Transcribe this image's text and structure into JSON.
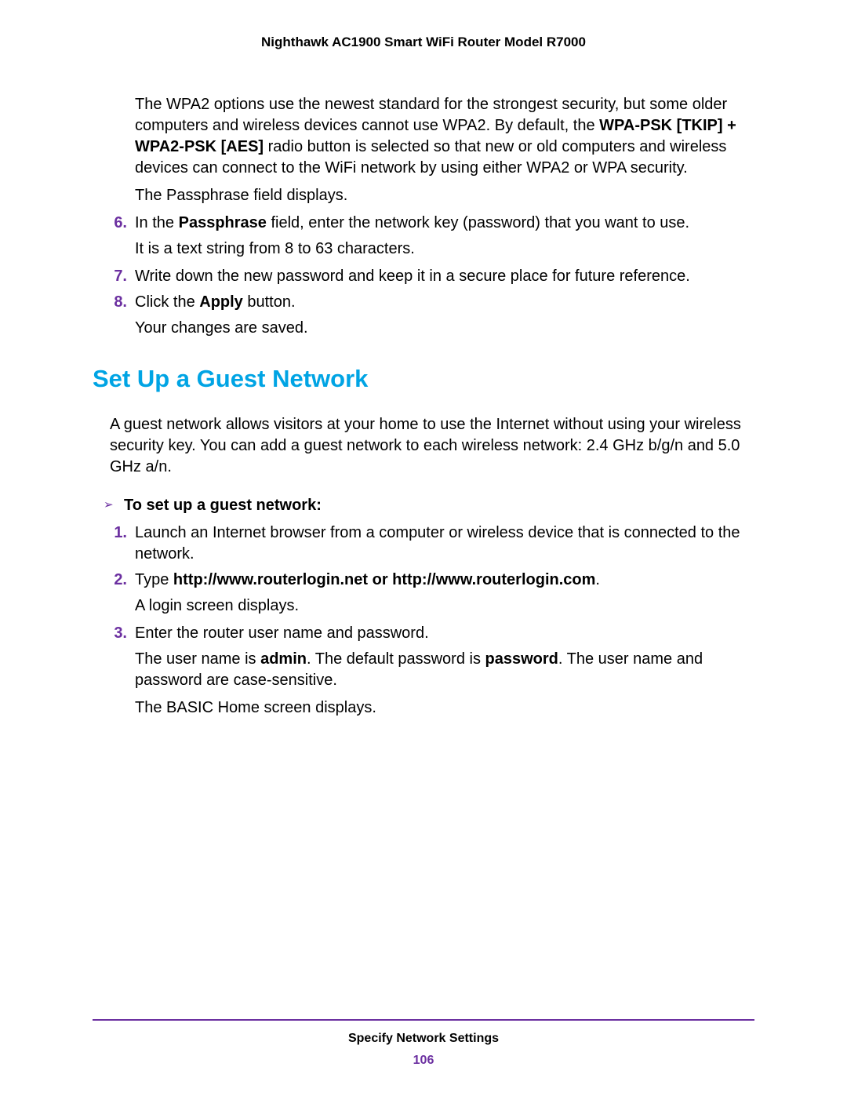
{
  "header": {
    "title": "Nighthawk AC1900 Smart WiFi Router Model R7000"
  },
  "section1": {
    "p1a": "The WPA2 options use the newest standard for the strongest security, but some older computers and wireless devices cannot use WPA2. By default, the ",
    "p1b": "WPA-PSK [TKIP] + WPA2-PSK [AES]",
    "p1c": " radio button is selected so that new or old computers and wireless devices can connect to the WiFi network by using either WPA2 or WPA security.",
    "p2": "The Passphrase field displays.",
    "i6": {
      "n": "6.",
      "a": "In the ",
      "b": "Passphrase",
      "c": " field, enter the network key (password) that you want to use.",
      "sub": "It is a text string from 8 to 63 characters."
    },
    "i7": {
      "n": "7.",
      "a": "Write down the new password and keep it in a secure place for future reference."
    },
    "i8": {
      "n": "8.",
      "a": "Click the ",
      "b": "Apply",
      "c": " button.",
      "sub": "Your changes are saved."
    }
  },
  "h2": "Set Up a Guest Network",
  "intro": "A guest network allows visitors at your home to use the Internet without using your wireless security key. You can add a guest network to each wireless network: 2.4 GHz b/g/n and 5.0 GHz a/n.",
  "proc": {
    "arrow": "➢",
    "title": "To set up a guest network:",
    "i1": {
      "n": "1.",
      "a": "Launch an Internet browser from a computer or wireless device that is connected to the network."
    },
    "i2": {
      "n": "2.",
      "pre": "Type ",
      "b1": "http://www.routerlogin.net",
      "mid": " or ",
      "b2": "http://www.routerlogin.com",
      "post": ".",
      "sub": "A login screen displays."
    },
    "i3": {
      "n": "3.",
      "a": "Enter the router user name and password.",
      "sub1a": "The user name is ",
      "sub1b": "admin",
      "sub1c": ". The default password is ",
      "sub1d": "password",
      "sub1e": ". The user name and password are case-sensitive.",
      "sub2": "The BASIC Home screen displays."
    }
  },
  "footer": {
    "chapter": "Specify Network Settings",
    "page": "106"
  }
}
